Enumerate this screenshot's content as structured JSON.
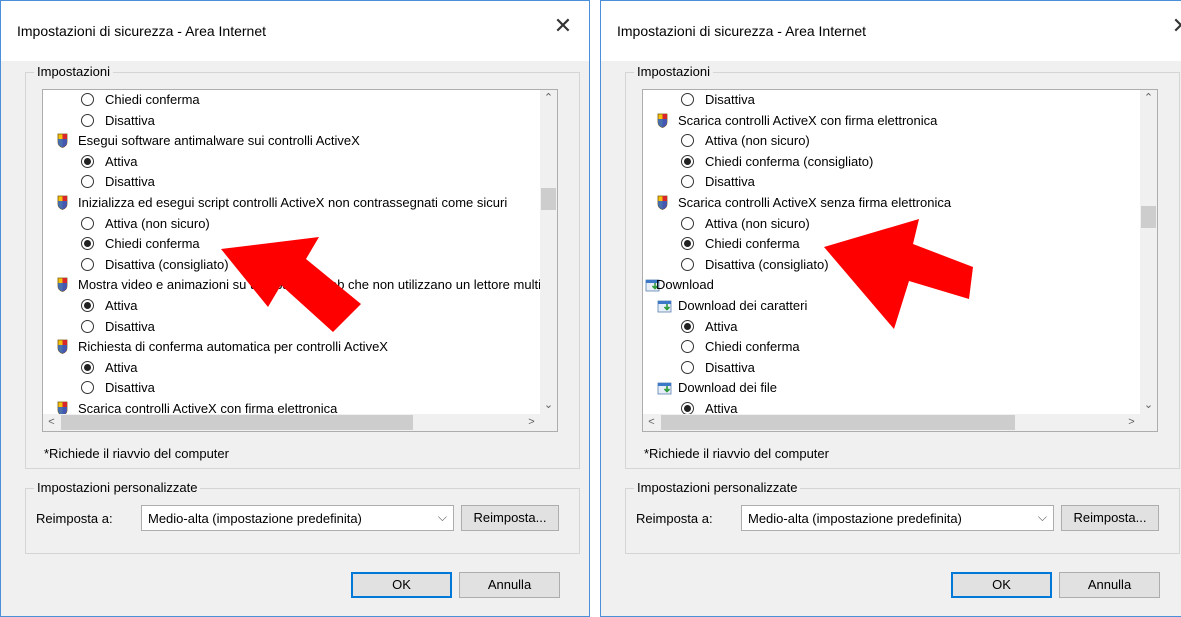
{
  "accent_color": "#0078d7",
  "arrow_color": "#ff0000",
  "dialogs": [
    {
      "title": "Impostazioni di sicurezza - Area Internet",
      "settings_group_label": "Impostazioni",
      "items": [
        {
          "kind": "radio",
          "label": "Chiedi conferma",
          "selected": false
        },
        {
          "kind": "radio",
          "label": "Disattiva",
          "selected": false
        },
        {
          "kind": "heading",
          "icon": "shield-icon",
          "label": "Esegui software antimalware sui controlli ActiveX"
        },
        {
          "kind": "radio",
          "label": "Attiva",
          "selected": true
        },
        {
          "kind": "radio",
          "label": "Disattiva",
          "selected": false
        },
        {
          "kind": "heading",
          "icon": "shield-icon",
          "label": "Inizializza ed esegui script controlli ActiveX non contrassegnati come sicuri"
        },
        {
          "kind": "radio",
          "label": "Attiva (non sicuro)",
          "selected": false
        },
        {
          "kind": "radio",
          "label": "Chiedi conferma",
          "selected": true
        },
        {
          "kind": "radio",
          "label": "Disattiva (consigliato)",
          "selected": false
        },
        {
          "kind": "heading",
          "icon": "shield-icon",
          "label": "Mostra video e animazioni su una pagina Web che non utilizzano un lettore multimediale esterno"
        },
        {
          "kind": "radio",
          "label": "Attiva",
          "selected": true
        },
        {
          "kind": "radio",
          "label": "Disattiva",
          "selected": false
        },
        {
          "kind": "heading",
          "icon": "shield-icon",
          "label": "Richiesta di conferma automatica per controlli ActiveX"
        },
        {
          "kind": "radio",
          "label": "Attiva",
          "selected": true
        },
        {
          "kind": "radio",
          "label": "Disattiva",
          "selected": false
        },
        {
          "kind": "heading",
          "icon": "shield-icon",
          "label": "Scarica controlli ActiveX con firma elettronica"
        }
      ],
      "note": "*Richiede il riavvio del computer",
      "custom_group_label": "Impostazioni personalizzate",
      "reset_to_label": "Reimposta a:",
      "level_value": "Medio-alta (impostazione predefinita)",
      "reset_button": "Reimposta...",
      "ok_button": "OK",
      "cancel_button": "Annulla"
    },
    {
      "title": "Impostazioni di sicurezza - Area Internet",
      "settings_group_label": "Impostazioni",
      "items": [
        {
          "kind": "radio",
          "label": "Disattiva",
          "selected": false
        },
        {
          "kind": "heading",
          "icon": "shield-icon",
          "label": "Scarica controlli ActiveX con firma elettronica"
        },
        {
          "kind": "radio",
          "label": "Attiva (non sicuro)",
          "selected": false
        },
        {
          "kind": "radio",
          "label": "Chiedi conferma (consigliato)",
          "selected": true
        },
        {
          "kind": "radio",
          "label": "Disattiva",
          "selected": false
        },
        {
          "kind": "heading",
          "icon": "shield-icon",
          "label": "Scarica controlli ActiveX senza firma elettronica"
        },
        {
          "kind": "radio",
          "label": "Attiva (non sicuro)",
          "selected": false
        },
        {
          "kind": "radio",
          "label": "Chiedi conferma",
          "selected": true
        },
        {
          "kind": "radio",
          "label": "Disattiva (consigliato)",
          "selected": false
        },
        {
          "kind": "category",
          "icon": "download-icon",
          "label": "Download"
        },
        {
          "kind": "heading",
          "icon": "download-icon",
          "label": "Download dei caratteri"
        },
        {
          "kind": "radio",
          "label": "Attiva",
          "selected": true
        },
        {
          "kind": "radio",
          "label": "Chiedi conferma",
          "selected": false
        },
        {
          "kind": "radio",
          "label": "Disattiva",
          "selected": false
        },
        {
          "kind": "heading",
          "icon": "download-icon",
          "label": "Download dei file"
        },
        {
          "kind": "radio",
          "label": "Attiva",
          "selected": true
        }
      ],
      "note": "*Richiede il riavvio del computer",
      "custom_group_label": "Impostazioni personalizzate",
      "reset_to_label": "Reimposta a:",
      "level_value": "Medio-alta (impostazione predefinita)",
      "reset_button": "Reimposta...",
      "ok_button": "OK",
      "cancel_button": "Annulla"
    }
  ]
}
